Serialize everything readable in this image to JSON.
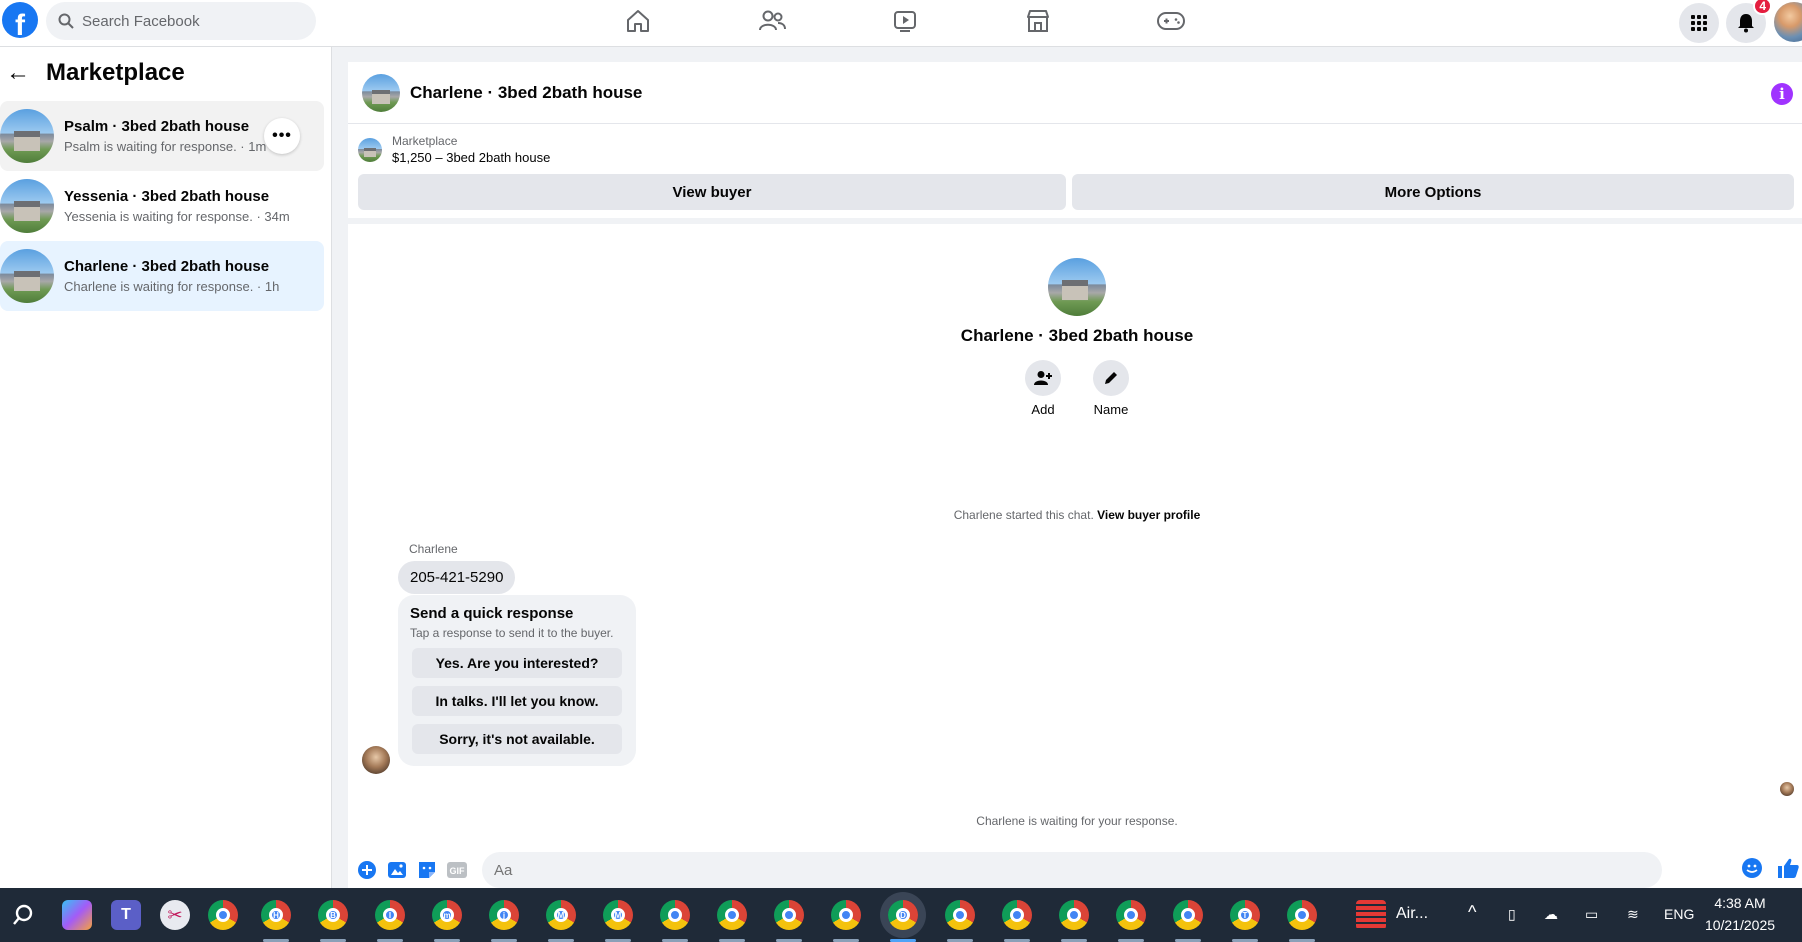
{
  "topbar": {
    "search_placeholder": "Search Facebook",
    "notification_count": "4",
    "nav_icons": [
      "home-icon",
      "friends-icon",
      "watch-icon",
      "marketplace-icon",
      "gaming-icon"
    ]
  },
  "sidebar": {
    "title": "Marketplace",
    "conversations": [
      {
        "name": "Psalm · 3bed 2bath house",
        "status": "Psalm is waiting for response. · 1m"
      },
      {
        "name": "Yessenia · 3bed 2bath house",
        "status": "Yessenia is waiting for response. · 34m"
      },
      {
        "name": "Charlene · 3bed 2bath house",
        "status": "Charlene is waiting for response. · 1h"
      }
    ]
  },
  "chat": {
    "title": "Charlene · 3bed 2bath house",
    "listing_label": "Marketplace",
    "listing_price": "$1,250 – 3bed 2bath house",
    "view_buyer": "View buyer",
    "more_options": "More Options",
    "profile_name": "Charlene · 3bed 2bath house",
    "add_label": "Add",
    "name_label": "Name",
    "started_text": "Charlene started this chat.",
    "view_profile": "View buyer profile",
    "sender": "Charlene",
    "phone_message": "205-421-5290",
    "quick_title": "Send a quick response",
    "quick_sub": "Tap a response to send it to the buyer.",
    "quick_responses": [
      "Yes. Are you interested?",
      "In talks. I'll let you know.",
      "Sorry, it's not available."
    ],
    "waiting_text": "Charlene is waiting for your response.",
    "input_placeholder": "Aa"
  },
  "taskbar": {
    "app_label": "Air...",
    "lang": "ENG",
    "time": "4:38 AM",
    "date": "10/21/2025",
    "chrome_letters": [
      "",
      "H",
      "B",
      "I",
      "m",
      "j",
      "M",
      "M",
      "",
      "",
      "",
      "",
      "D",
      "",
      "",
      "",
      "",
      "",
      "T",
      ""
    ]
  },
  "colors": {
    "accent": "#1877f2",
    "active_conv": "#e7f3ff",
    "info": "#a033ff",
    "badge": "#e41e3f"
  }
}
